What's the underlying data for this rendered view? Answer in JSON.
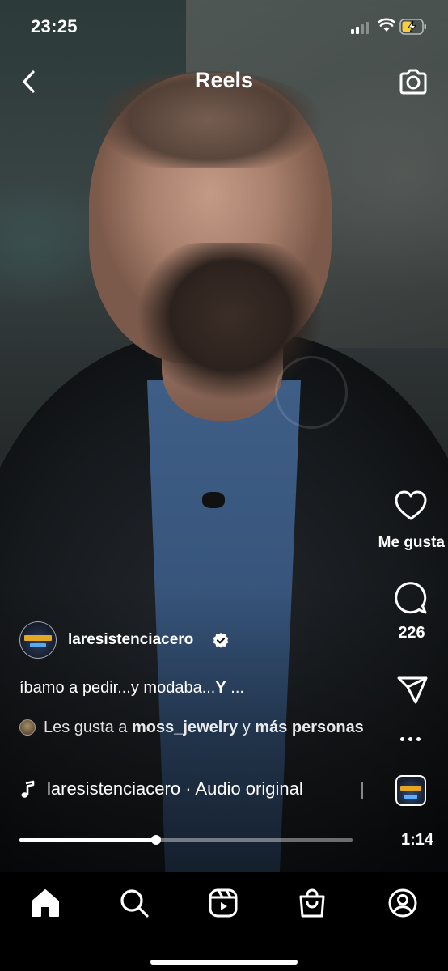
{
  "status_bar": {
    "time": "23:25",
    "signal_icon": "cellular-signal-icon",
    "wifi_icon": "wifi-icon",
    "battery_icon": "battery-charging-icon"
  },
  "header": {
    "title": "Reels",
    "back_icon": "chevron-left-icon",
    "camera_icon": "camera-icon"
  },
  "rail": {
    "like_icon": "heart-icon",
    "like_label": "Me gusta",
    "comment_icon": "comment-bubble-icon",
    "comment_count": "226",
    "share_icon": "paper-plane-icon",
    "more_icon": "more-horizontal-icon",
    "audio_thumb": "audio-cover-thumbnail",
    "duration": "1:14"
  },
  "post": {
    "username": "laresistenciacero",
    "verified_icon": "verified-badge-icon",
    "caption_prefix": "íbamo a pedir...y modaba...",
    "caption_bold": "Y",
    "caption_suffix": " ...",
    "likes_prefix": "Les gusta a ",
    "likes_user": "moss_jewelry",
    "likes_and": " y ",
    "likes_more": "más personas",
    "audio_icon": "music-note-icon",
    "audio_text": "laresistenciacero · Audio original"
  },
  "playback": {
    "progress": 0.41
  },
  "nav": {
    "items": [
      {
        "icon": "home-icon",
        "active": true
      },
      {
        "icon": "search-icon",
        "active": false
      },
      {
        "icon": "reels-icon",
        "active": false
      },
      {
        "icon": "shopping-bag-icon",
        "active": false
      },
      {
        "icon": "profile-icon",
        "active": false
      }
    ]
  },
  "colors": {
    "background": "#000000",
    "text": "#ffffff",
    "logo_yellow": "#e3a925",
    "logo_blue": "#59a9f0"
  }
}
